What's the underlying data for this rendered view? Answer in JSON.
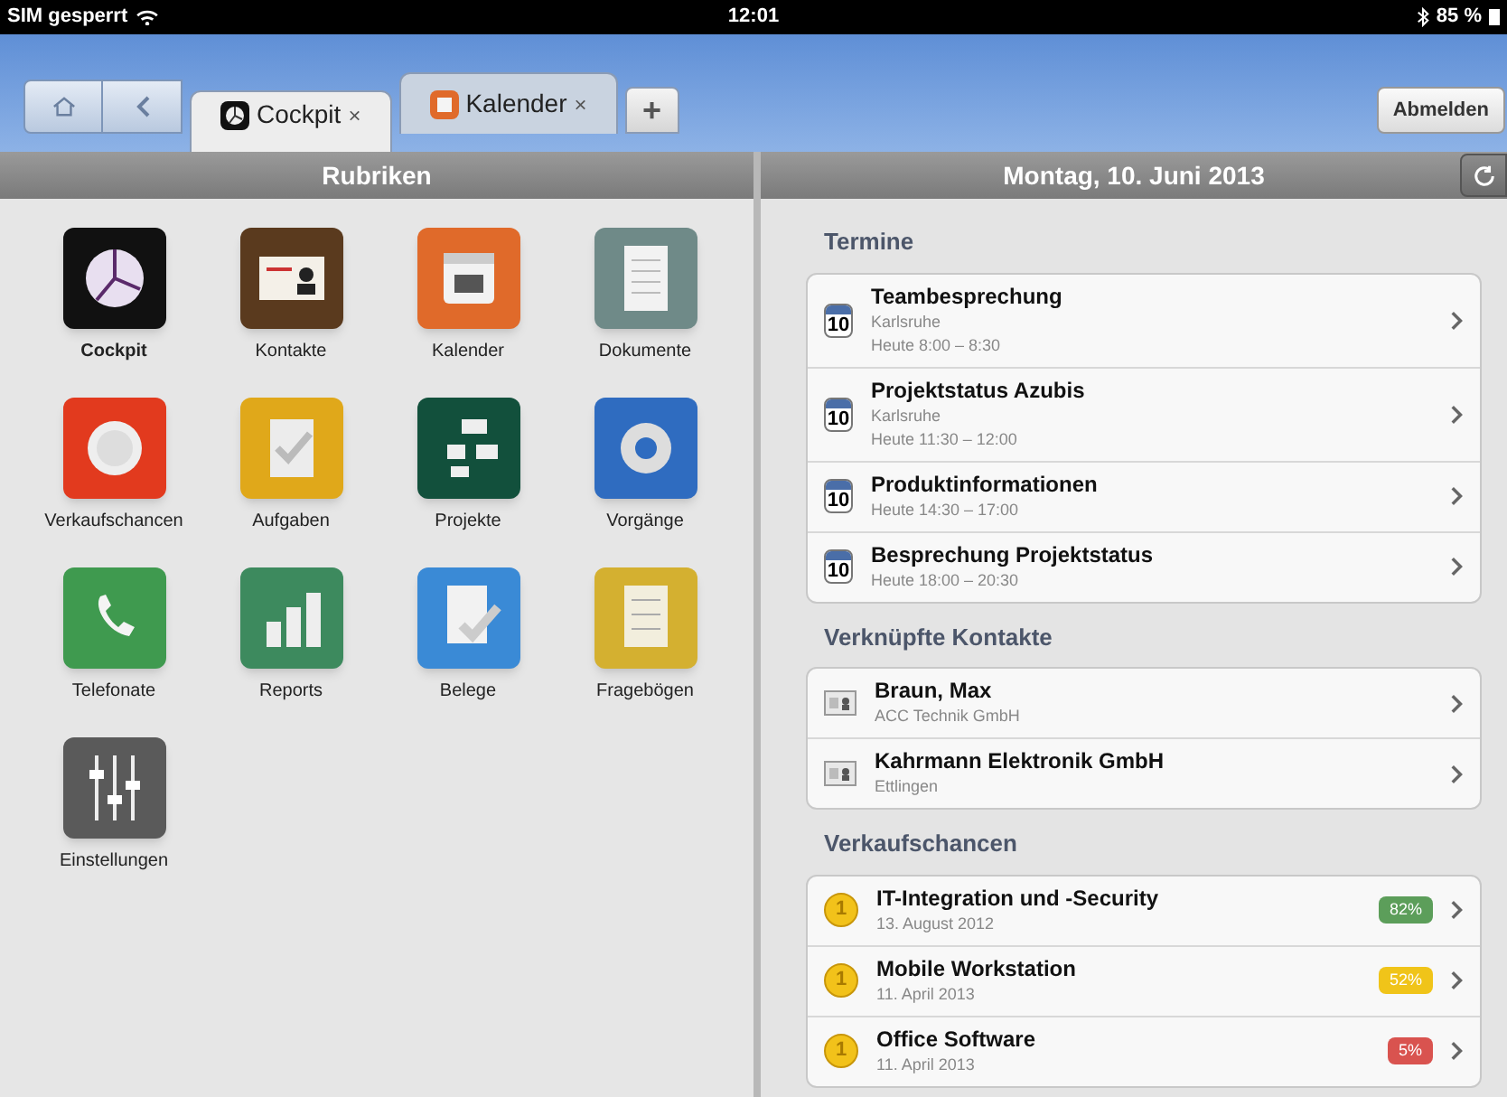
{
  "status_bar": {
    "carrier": "SIM gesperrt",
    "time": "12:01",
    "battery": "85 %"
  },
  "tab_bar": {
    "tabs": [
      {
        "label": "Cockpit",
        "close": "×",
        "selected": true
      },
      {
        "label": "Kalender",
        "close": "×",
        "selected": false
      }
    ],
    "add": "+",
    "logout": "Abmelden"
  },
  "left_panel": {
    "title": "Rubriken",
    "items": [
      {
        "label": "Cockpit",
        "selected": true
      },
      {
        "label": "Kontakte",
        "selected": false
      },
      {
        "label": "Kalender",
        "selected": false
      },
      {
        "label": "Dokumente",
        "selected": false
      },
      {
        "label": "Verkaufschancen",
        "selected": false
      },
      {
        "label": "Aufgaben",
        "selected": false
      },
      {
        "label": "Projekte",
        "selected": false
      },
      {
        "label": "Vorgänge",
        "selected": false
      },
      {
        "label": "Telefonate",
        "selected": false
      },
      {
        "label": "Reports",
        "selected": false
      },
      {
        "label": "Belege",
        "selected": false
      },
      {
        "label": "Fragebögen",
        "selected": false
      },
      {
        "label": "Einstellungen",
        "selected": false
      }
    ]
  },
  "right_panel": {
    "title": "Montag, 10. Juni 2013",
    "sections": [
      {
        "title": "Termine",
        "kind": "appointment",
        "rows": [
          {
            "icon_text": "10",
            "title": "Teambesprechung",
            "lines": [
              "Karlsruhe",
              "Heute 8:00 – 8:30"
            ]
          },
          {
            "icon_text": "10",
            "title": "Projektstatus Azubis",
            "lines": [
              "Karlsruhe",
              "Heute 11:30 – 12:00"
            ]
          },
          {
            "icon_text": "10",
            "title": "Produktinformationen",
            "lines": [
              "Heute 14:30 – 17:00"
            ]
          },
          {
            "icon_text": "10",
            "title": "Besprechung Projektstatus",
            "lines": [
              "Heute 18:00 – 20:30"
            ]
          }
        ]
      },
      {
        "title": "Verknüpfte Kontakte",
        "kind": "contact",
        "rows": [
          {
            "title": "Braun, Max",
            "lines": [
              "ACC Technik GmbH"
            ]
          },
          {
            "title": "Kahrmann Elektronik GmbH",
            "lines": [
              "Ettlingen"
            ]
          }
        ]
      },
      {
        "title": "Verkaufschancen",
        "kind": "opportunity",
        "rows": [
          {
            "icon_text": "1",
            "title": "IT-Integration und -Security",
            "lines": [
              "13. August 2012"
            ],
            "badge": "82%",
            "color": "#5c9e5a"
          },
          {
            "icon_text": "1",
            "title": "Mobile Workstation",
            "lines": [
              "11. April 2013"
            ],
            "badge": "52%",
            "color": "#f0c419"
          },
          {
            "icon_text": "1",
            "title": "Office Software",
            "lines": [
              "11. April 2013"
            ],
            "badge": "5%",
            "color": "#d9534f"
          }
        ]
      }
    ]
  }
}
